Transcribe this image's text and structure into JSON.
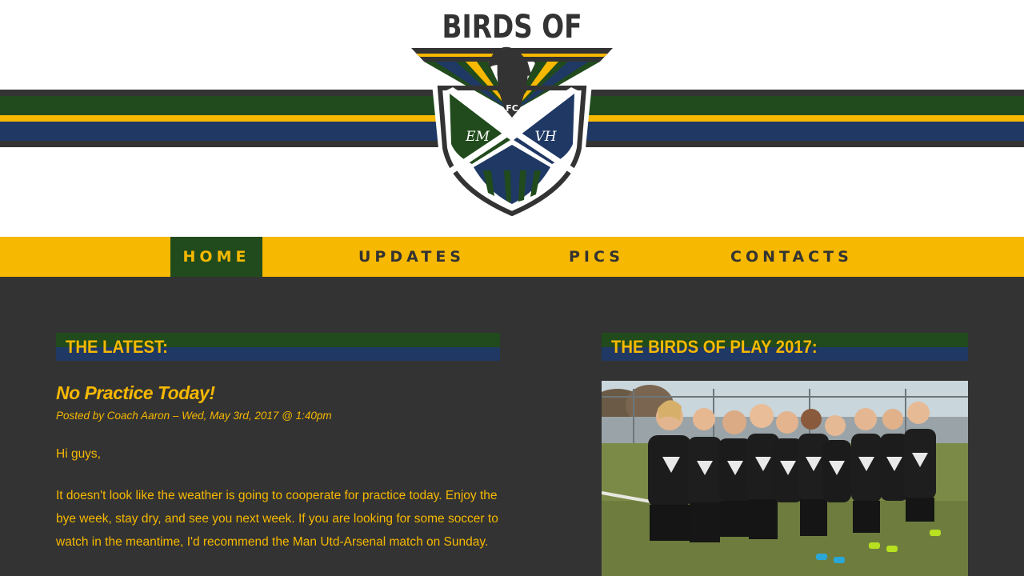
{
  "site": {
    "logo_title": "BIRDS OF PLAY",
    "crest": {
      "fc": "FC",
      "left_initials": "EM",
      "right_initials": "VH"
    }
  },
  "nav": {
    "items": [
      {
        "label": "HOME",
        "active": true
      },
      {
        "label": "UPDATES",
        "active": false
      },
      {
        "label": "PICS",
        "active": false
      },
      {
        "label": "CONTACTS",
        "active": false
      }
    ]
  },
  "latest": {
    "heading": "THE LATEST:",
    "post": {
      "title": "No Practice Today!",
      "meta": "Posted by Coach Aaron – Wed, May 3rd, 2017 @ 1:40pm",
      "paragraphs": [
        "Hi guys,",
        "It doesn't look like the weather is going to cooperate for practice today. Enjoy the bye week, stay dry, and see you next week. If you are looking for some soccer to watch in the meantime, I'd recommend the Man Utd-Arsenal match on Sunday."
      ]
    }
  },
  "team": {
    "heading": "THE BIRDS OF PLAY 2017:"
  },
  "colors": {
    "dark": "#333333",
    "gold": "#f6b800",
    "green": "#214b1c",
    "blue": "#1f3864",
    "white": "#ffffff"
  }
}
